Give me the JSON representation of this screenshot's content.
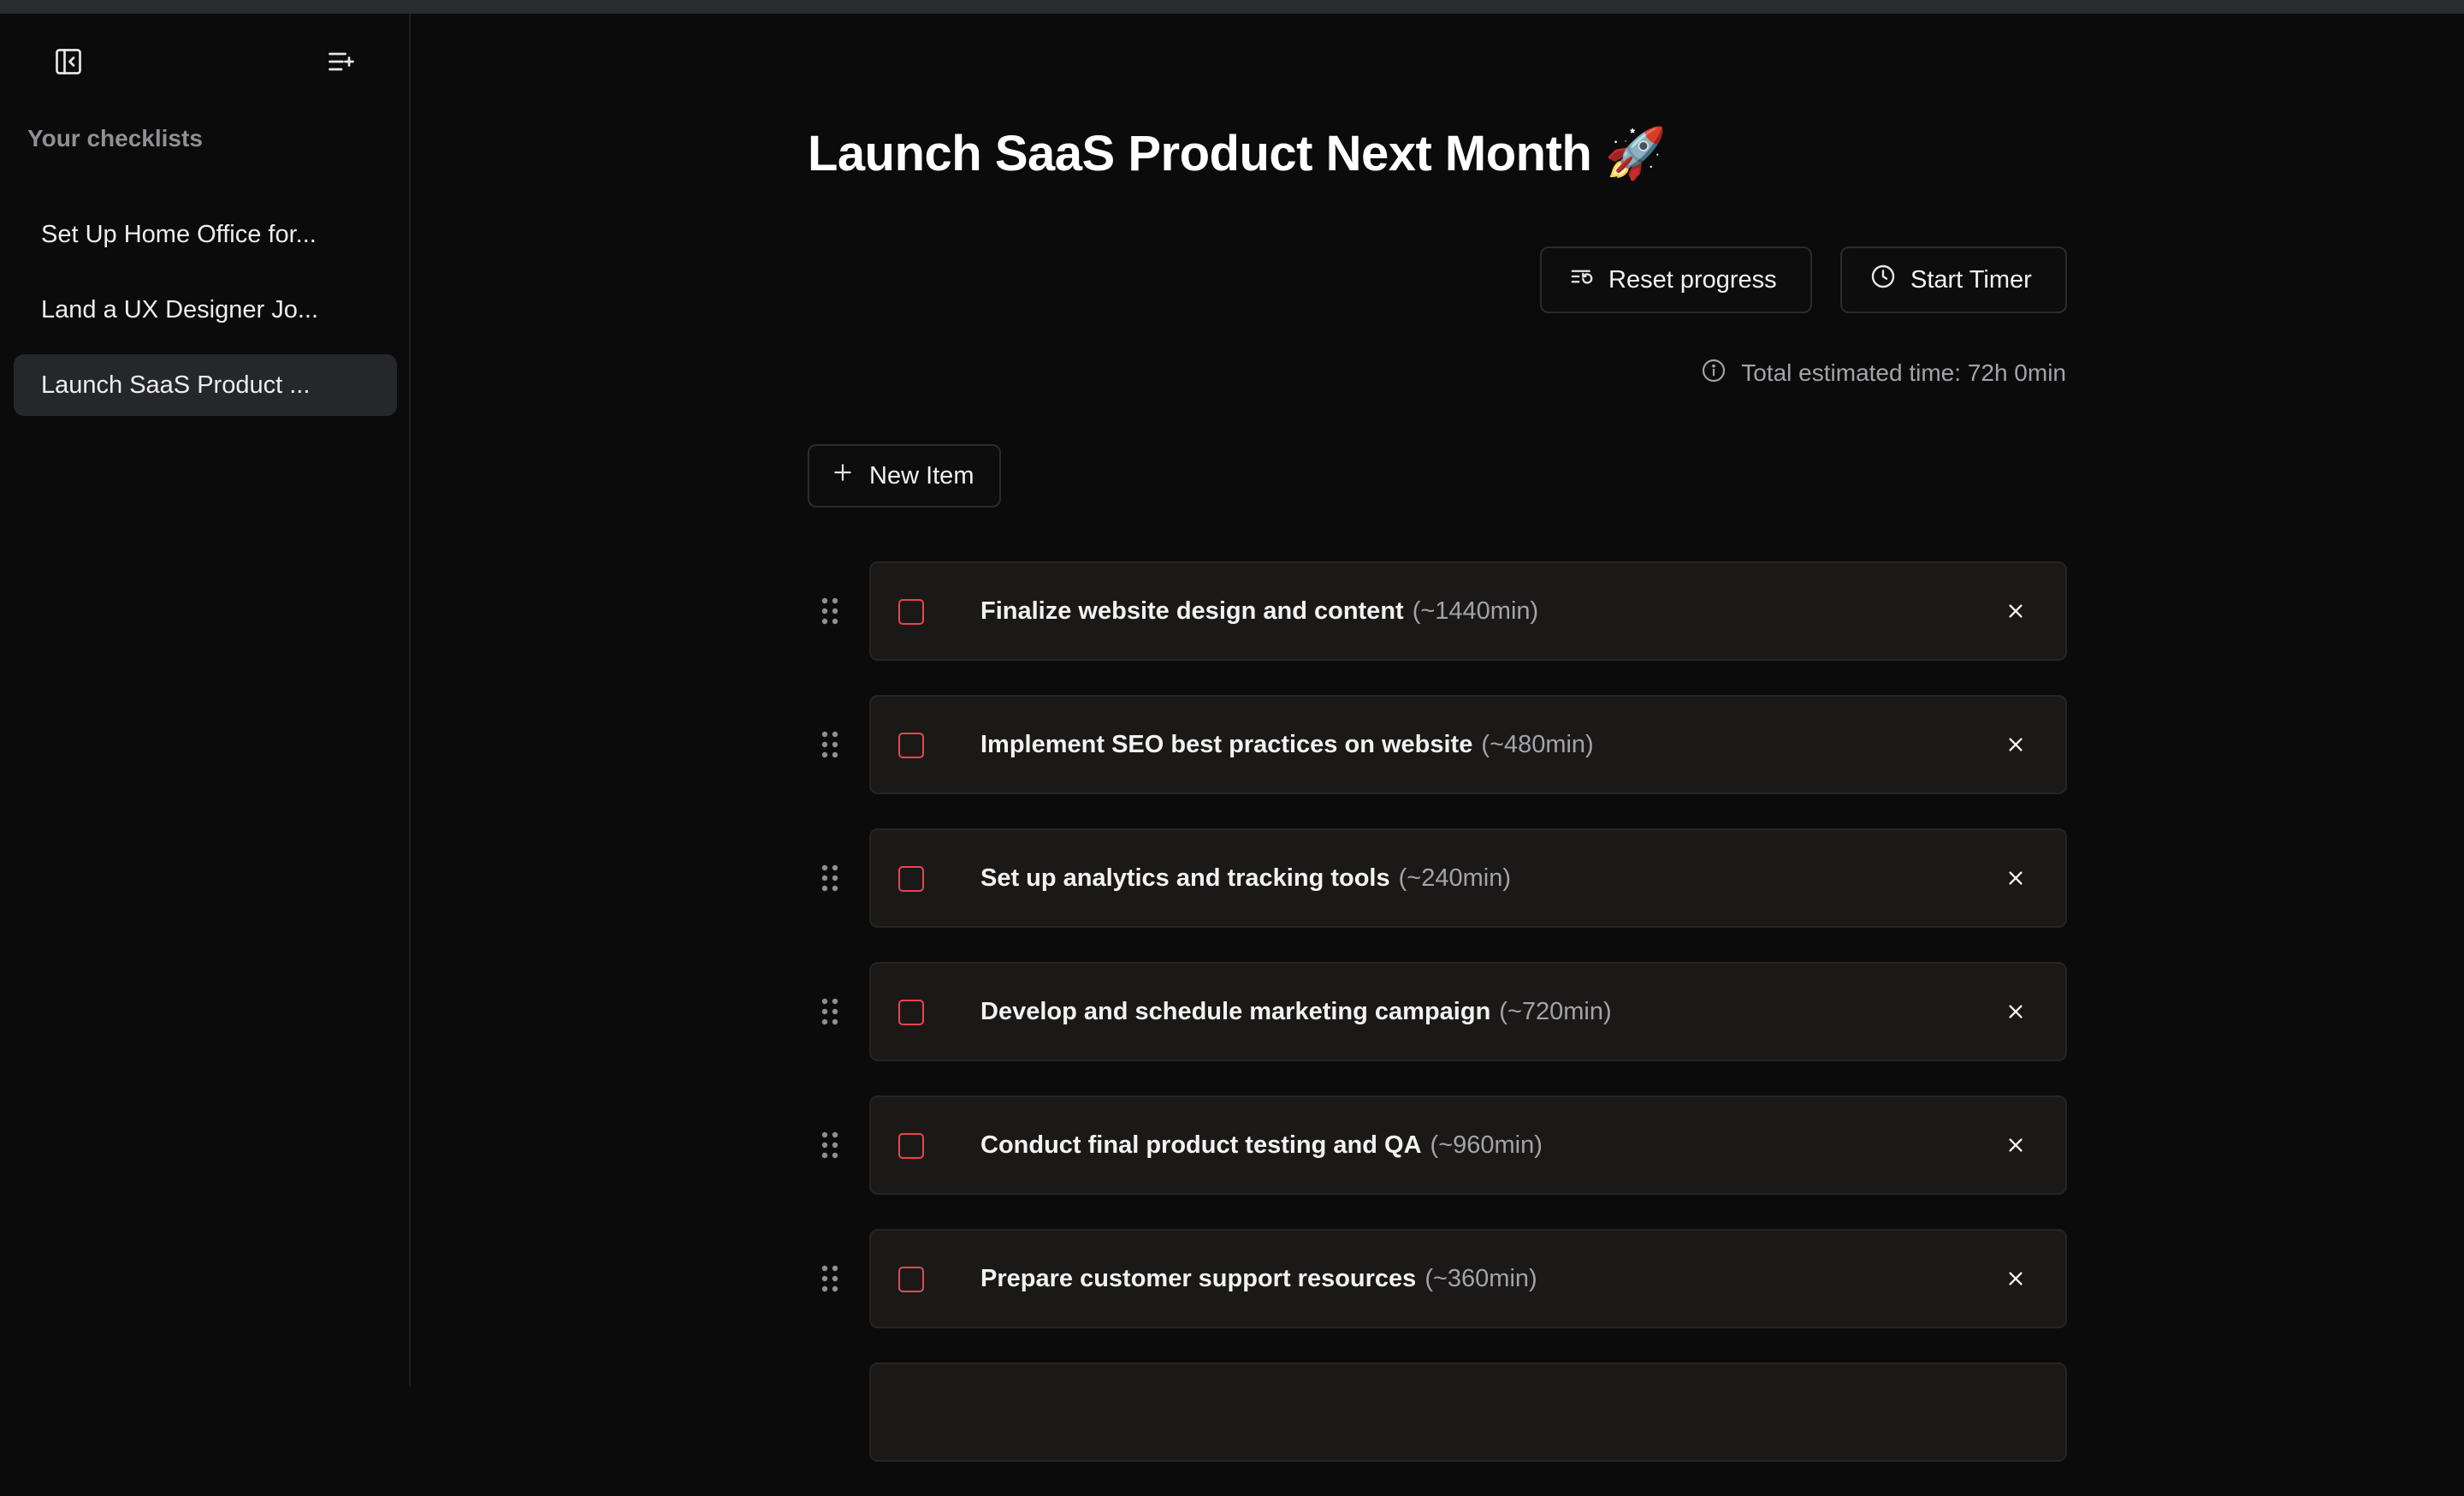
{
  "sidebar": {
    "collapse_icon": "sidebar-collapse-icon",
    "new_list_icon": "list-add-icon",
    "heading": "Your checklists",
    "items": [
      {
        "label": "Set Up Home Office for...",
        "active": false
      },
      {
        "label": "Land a UX Designer Jo...",
        "active": false
      },
      {
        "label": "Launch SaaS Product ...",
        "active": true
      }
    ]
  },
  "header": {
    "title": "Launch SaaS Product Next Month 🚀"
  },
  "toolbar": {
    "reset_label": "Reset progress",
    "reset_icon": "reset-list-icon",
    "timer_label": "Start Timer",
    "timer_icon": "clock-icon"
  },
  "estimate": {
    "icon": "info-icon",
    "text": "Total estimated time: 72h 0min"
  },
  "new_item": {
    "label": "New Item",
    "icon": "plus-icon"
  },
  "items": [
    {
      "title": "Finalize website design and content",
      "time": "(~1440min)",
      "checked": false
    },
    {
      "title": "Implement SEO best practices on website",
      "time": "(~480min)",
      "checked": false
    },
    {
      "title": "Set up analytics and tracking tools",
      "time": "(~240min)",
      "checked": false
    },
    {
      "title": "Develop and schedule marketing campaign",
      "time": "(~720min)",
      "checked": false
    },
    {
      "title": "Conduct final product testing and QA",
      "time": "(~960min)",
      "checked": false
    },
    {
      "title": "Prepare customer support resources",
      "time": "(~360min)",
      "checked": false
    },
    {
      "title": "",
      "time": "",
      "checked": false
    }
  ],
  "colors": {
    "background": "#0b0b0b",
    "card": "#1a1918",
    "checkbox_border": "#e5484d",
    "active_sidebar_item": "#26272b",
    "muted_text": "#a3a3a8"
  }
}
